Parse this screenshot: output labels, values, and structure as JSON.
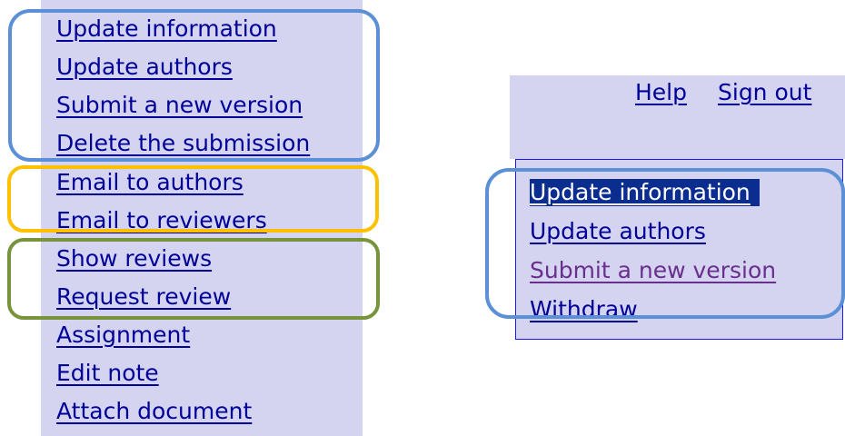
{
  "colors": {
    "panel_bg": "#d4d4f0",
    "link": "#000099",
    "visited": "#6a2f8e",
    "selected_bg": "#0b2d8f",
    "border_blue": "#1a1aee",
    "highlight_blue": "#5b8fd6",
    "highlight_orange": "#ffc000",
    "highlight_green": "#77933c"
  },
  "left_menu": {
    "items": [
      {
        "label": "Update information"
      },
      {
        "label": "Update authors"
      },
      {
        "label": "Submit a new version"
      },
      {
        "label": "Delete the submission"
      },
      {
        "label": "Email to authors"
      },
      {
        "label": "Email to reviewers"
      },
      {
        "label": "Show reviews"
      },
      {
        "label": "Request review"
      },
      {
        "label": "Assignment"
      },
      {
        "label": "Edit note"
      },
      {
        "label": "Attach document"
      }
    ]
  },
  "right_panel": {
    "header_links": {
      "help": "Help",
      "sign_out": "Sign out"
    },
    "menu_items": [
      {
        "label": "Update information",
        "state": "selected"
      },
      {
        "label": "Update authors",
        "state": "normal"
      },
      {
        "label": "Submit a new version",
        "state": "visited"
      },
      {
        "label": "Withdraw",
        "state": "normal"
      }
    ]
  }
}
